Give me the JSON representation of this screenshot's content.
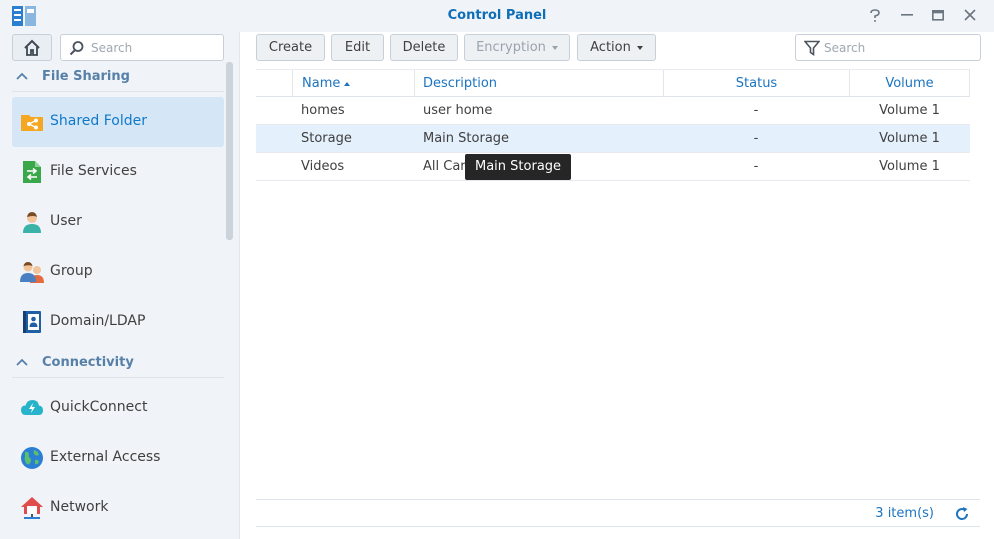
{
  "window": {
    "title": "Control Panel",
    "controls": [
      "help-icon",
      "minimize-icon",
      "maximize-icon",
      "close-icon"
    ]
  },
  "sidebar": {
    "search_placeholder": "Search",
    "sections": [
      {
        "title": "File Sharing",
        "items": [
          {
            "label": "Shared Folder",
            "icon": "shared-folder-icon",
            "active": true
          },
          {
            "label": "File Services",
            "icon": "file-services-icon"
          },
          {
            "label": "User",
            "icon": "user-icon"
          },
          {
            "label": "Group",
            "icon": "group-icon"
          },
          {
            "label": "Domain/LDAP",
            "icon": "domain-ldap-icon"
          }
        ]
      },
      {
        "title": "Connectivity",
        "items": [
          {
            "label": "QuickConnect",
            "icon": "quickconnect-icon"
          },
          {
            "label": "External Access",
            "icon": "external-access-icon"
          },
          {
            "label": "Network",
            "icon": "network-icon"
          }
        ]
      }
    ]
  },
  "toolbar": {
    "create": "Create",
    "edit": "Edit",
    "delete": "Delete",
    "encryption": "Encryption",
    "action": "Action",
    "search_placeholder": "Search"
  },
  "table": {
    "columns": [
      "Name",
      "Description",
      "Status",
      "Volume"
    ],
    "sorted_column": "Name",
    "sort_direction": "ascending",
    "rows": [
      {
        "name": "homes",
        "description": "user home",
        "status": "-",
        "volume": "Volume 1"
      },
      {
        "name": "Storage",
        "description": "Main Storage",
        "status": "-",
        "volume": "Volume 1",
        "selected": true
      },
      {
        "name": "Videos",
        "description": "All Cartoons",
        "status": "-",
        "volume": "Volume 1"
      }
    ]
  },
  "tooltip": {
    "text": "Main Storage"
  },
  "footer": {
    "count": "3 item(s)"
  },
  "colors": {
    "accent": "#1b74c0",
    "title": "#0f6eb8",
    "selected_row": "#e4f0fb",
    "active_nav": "#d5e7f7"
  }
}
